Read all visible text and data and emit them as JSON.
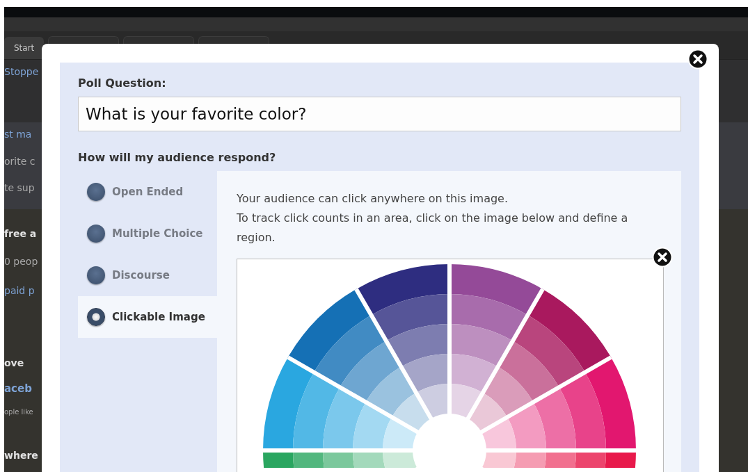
{
  "background": {
    "toolbar_button": "Start",
    "side_texts": [
      {
        "text": "Stoppe",
        "kind": "link"
      },
      {
        "text": "st ma",
        "kind": "link"
      },
      {
        "text": "orite c",
        "kind": "plain"
      },
      {
        "text": "te sup",
        "kind": "plain"
      },
      {
        "text": "free a",
        "kind": "bold"
      },
      {
        "text": "0 peop",
        "kind": "plain"
      },
      {
        "text": "paid p",
        "kind": "link"
      },
      {
        "text": "ove",
        "kind": "bold"
      },
      {
        "text": "aceb",
        "kind": "boldlink"
      },
      {
        "text": "ople like",
        "kind": "small"
      },
      {
        "text": "where",
        "kind": "bold"
      }
    ]
  },
  "dialog": {
    "question_label": "Poll Question:",
    "question_value": "What is your favorite color?",
    "response_label": "How will my audience respond?",
    "options": [
      {
        "label": "Open Ended",
        "selected": false
      },
      {
        "label": "Multiple Choice",
        "selected": false
      },
      {
        "label": "Discourse",
        "selected": false
      },
      {
        "label": "Clickable Image",
        "selected": true
      }
    ],
    "description": [
      "Your audience can click anywhere on this image.",
      "To track click counts in an area, click on the image below and define a region."
    ]
  }
}
